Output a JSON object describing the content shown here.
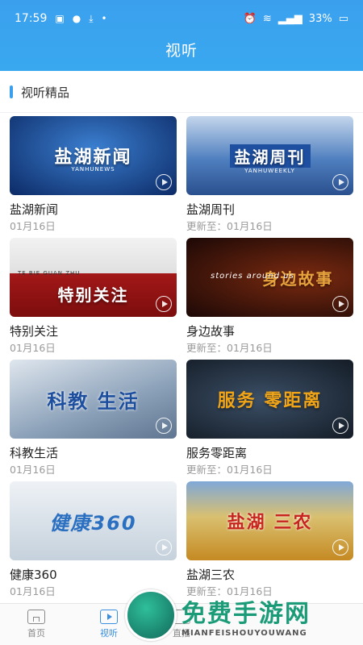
{
  "status": {
    "time": "17:59",
    "battery": "33%"
  },
  "header": {
    "title": "视听"
  },
  "section": {
    "label": "视听精品"
  },
  "cards": [
    {
      "title": "盐湖新闻",
      "date": "01月16日",
      "logo": "盐湖新闻",
      "sub": "YANHUNEWS",
      "bg": "#1a3f8c"
    },
    {
      "title": "盐湖周刊",
      "date": "更新至：01月16日",
      "logo": "盐湖周刊",
      "sub": "YANHUWEEKLY",
      "bg": "#5a86c8"
    },
    {
      "title": "特别关注",
      "date": "01月16日",
      "logo": "特别关注",
      "sub": "TE BIE GUAN ZHU",
      "bg": "#9a1a1a"
    },
    {
      "title": "身边故事",
      "date": "更新至：01月16日",
      "logo": "身边故事",
      "sub": "stories around us",
      "bg": "#3a1410"
    },
    {
      "title": "科教生活",
      "date": "01月16日",
      "logo": "科教 生活",
      "sub": "",
      "bg": "#8fa3b8"
    },
    {
      "title": "服务零距离",
      "date": "更新至：01月16日",
      "logo": "服务 零距离",
      "sub": "",
      "bg": "#1f2a36"
    },
    {
      "title": "健康360",
      "date": "01月16日",
      "logo": "健康360",
      "sub": "",
      "bg": "#c8d4de"
    },
    {
      "title": "盐湖三农",
      "date": "更新至：01月16日",
      "logo": "盐湖 三农",
      "sub": "",
      "bg": "#c99a2e"
    }
  ],
  "nav": [
    {
      "label": "首页",
      "icon": "home-icon"
    },
    {
      "label": "视听",
      "icon": "video-icon"
    },
    {
      "label": "直播",
      "icon": "live-icon"
    }
  ],
  "watermark": {
    "main": "免费手游网",
    "sub": "MIANFEISHOUYOUWANG"
  }
}
